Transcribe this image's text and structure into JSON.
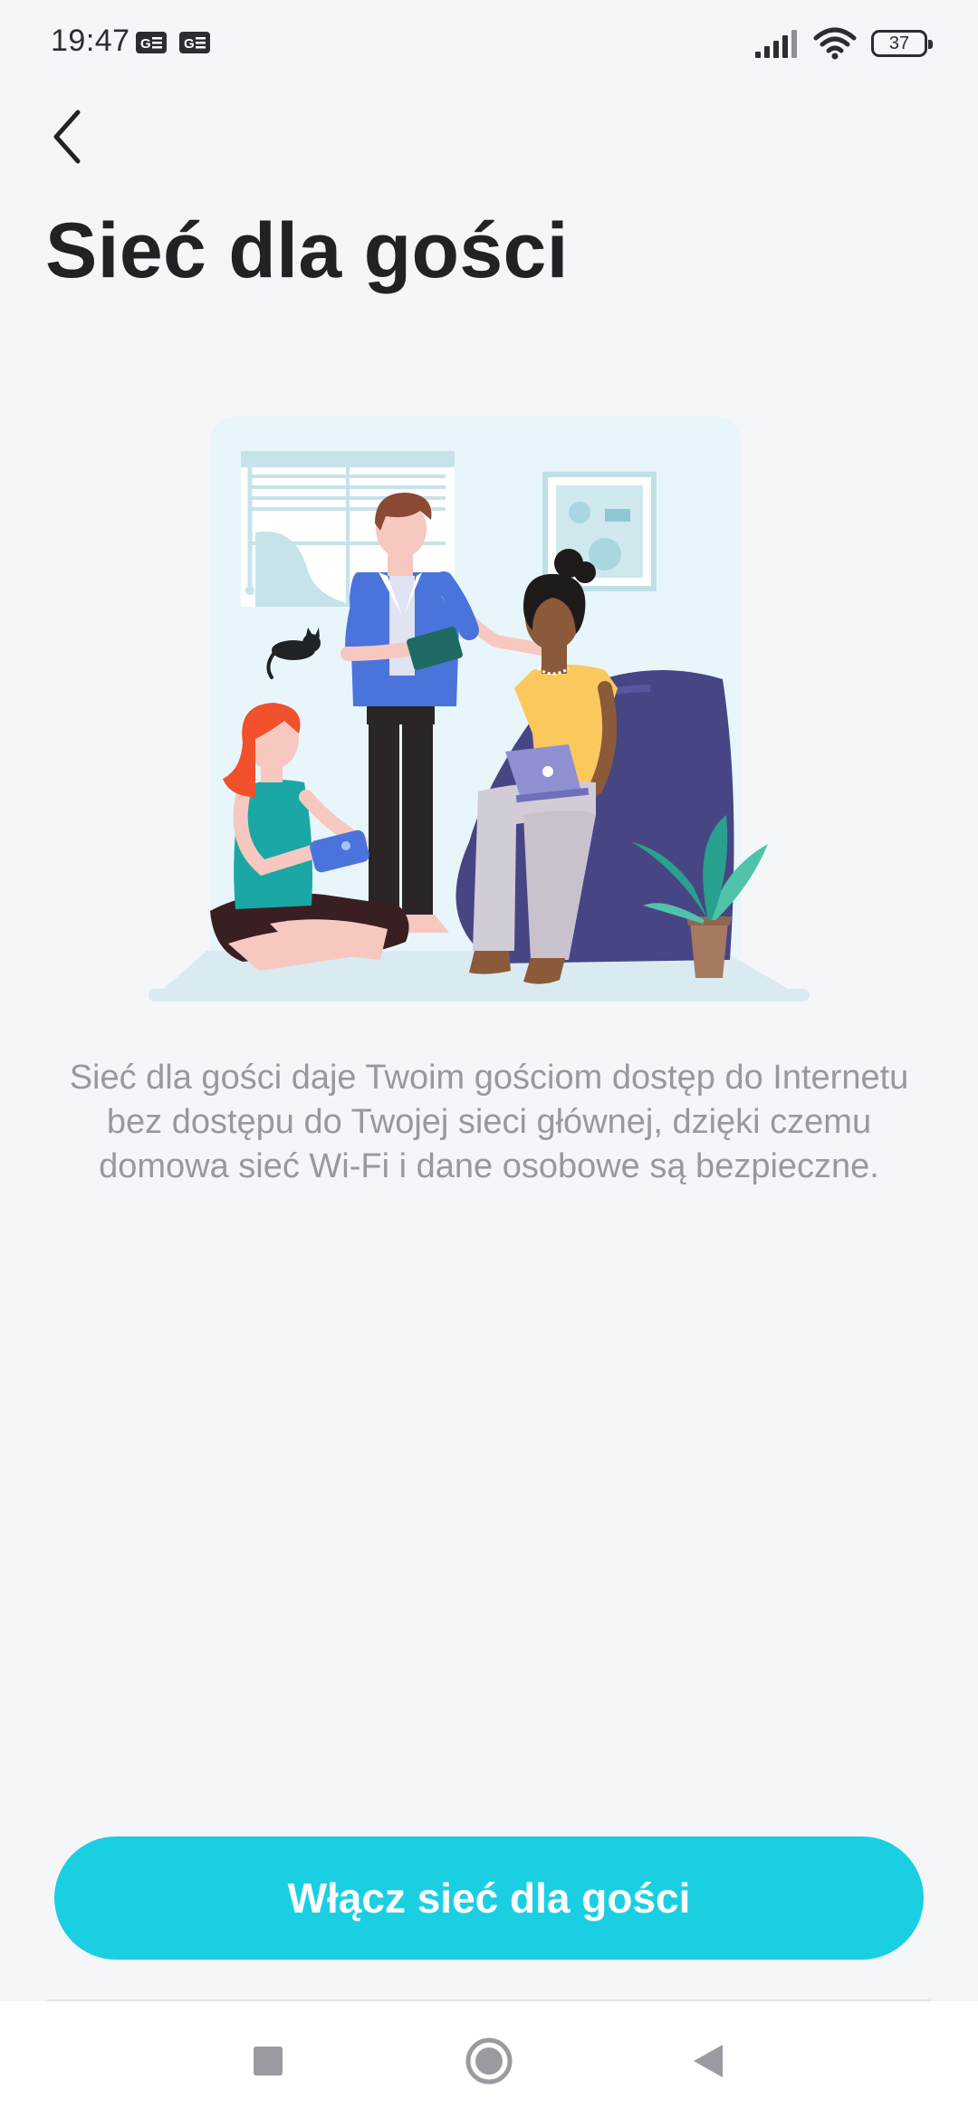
{
  "status_bar": {
    "time": "19:47",
    "notification_icons": [
      "notification-app-icon",
      "notification-app-icon"
    ],
    "signal_icon": "signal-bars-icon",
    "wifi_icon": "wifi-icon",
    "battery_level": "37"
  },
  "header": {
    "back_icon": "chevron-left-icon",
    "title": "Sieć dla gości"
  },
  "illustration": {
    "subject": "guest-network-illustration"
  },
  "description": "Sieć dla gości daje Twoim gościom dostęp do Internetu bez dostępu do Twojej sieci głównej, dzięki czemu domowa sieć Wi-Fi i dane osobowe są bezpieczne.",
  "primary_button": {
    "label": "Włącz sieć dla gości",
    "color": "#1bcfe3"
  },
  "navigation_bar": {
    "recents_icon": "square-icon",
    "home_icon": "circle-icon",
    "back_icon": "triangle-back-icon"
  }
}
